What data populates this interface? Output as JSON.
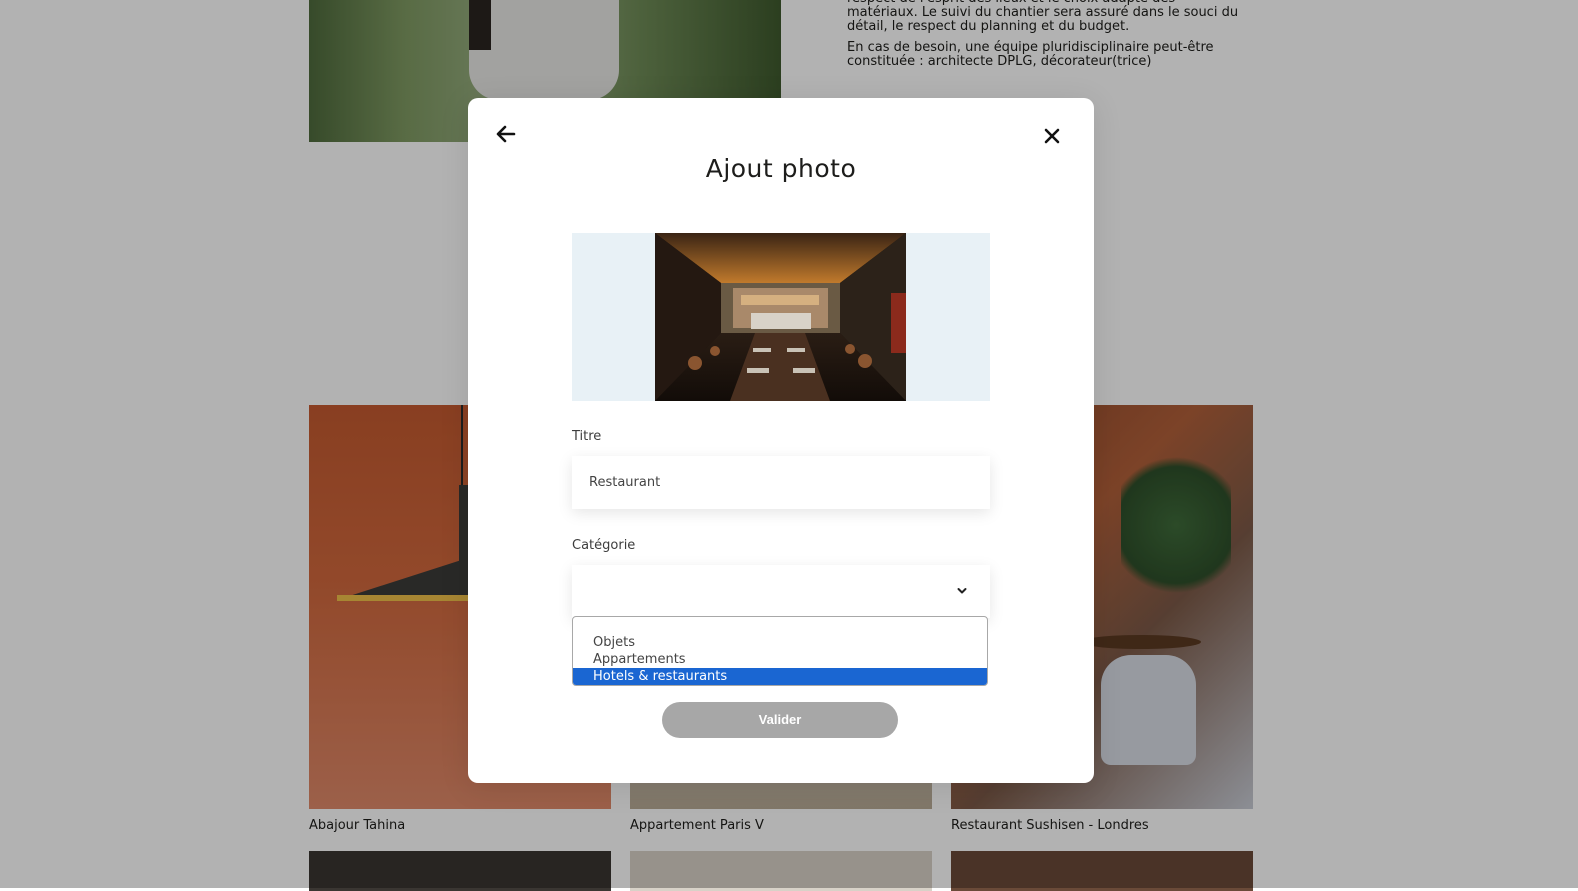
{
  "background": {
    "about": {
      "paragraph1": "respect de l'esprit des lieux et le choix adapté des matériaux. Le suivi du chantier sera assuré dans le souci du détail, le respect du planning et du budget.",
      "paragraph2": "En cas de besoin, une équipe pluridisciplinaire peut-être constituée : architecte DPLG, décorateur(trice)"
    },
    "gallery": [
      {
        "caption": "Abajour Tahina"
      },
      {
        "caption": "Appartement Paris V"
      },
      {
        "caption": "Restaurant Sushisen - Londres"
      }
    ]
  },
  "modal": {
    "title": "Ajout photo",
    "title_field": {
      "label": "Titre",
      "value": "Restaurant"
    },
    "category_field": {
      "label": "Catégorie",
      "value": "",
      "options": [
        "Objets",
        "Appartements",
        "Hotels & restaurants"
      ],
      "highlighted": "Hotels & restaurants"
    },
    "submit_label": "Valider"
  },
  "icons": {
    "back": "arrow-left-icon",
    "close": "close-icon",
    "chevron": "chevron-down-icon"
  },
  "colors": {
    "overlay": "rgba(0,0,0,0.30)",
    "preview_background": "#e8f1f6",
    "submit_disabled": "#a7a7a7",
    "option_highlight": "#1a66d2"
  }
}
